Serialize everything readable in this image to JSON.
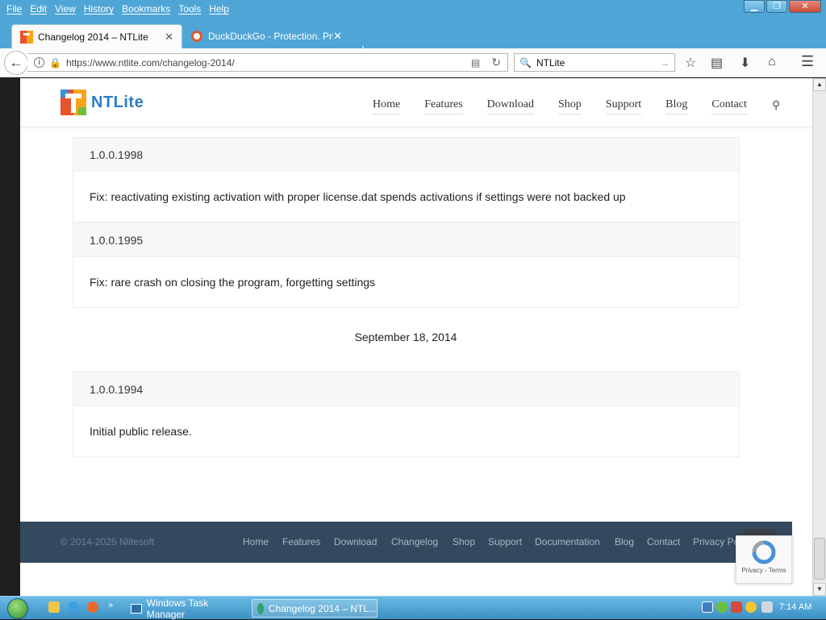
{
  "menubar": {
    "items": [
      "File",
      "Edit",
      "View",
      "History",
      "Bookmarks",
      "Tools",
      "Help"
    ]
  },
  "tabs": [
    {
      "title": "Changelog 2014 – NTLite",
      "active": true
    },
    {
      "title": "DuckDuckGo - Protection. Priva",
      "active": false
    }
  ],
  "navbar": {
    "url": "https://www.ntlite.com/changelog-2014/",
    "url_domain": "ntlite.com",
    "search_value": "NTLite"
  },
  "site": {
    "logo_text": "NTLite",
    "nav": [
      "Home",
      "Features",
      "Download",
      "Shop",
      "Support",
      "Blog",
      "Contact"
    ]
  },
  "entries": [
    {
      "version": "1.0.0.1998",
      "text": "Fix: reactivating existing activation with proper license.dat spends activations if settings were not backed up"
    },
    {
      "version": "1.0.0.1995",
      "text": "Fix: rare crash on closing the program, forgetting settings"
    },
    {
      "version": "1.0.0.1994",
      "text": "Initial public release."
    }
  ],
  "date_heading": "September 18, 2014",
  "footer": {
    "copyright": "© 2014-2025 Nlitesoft",
    "links": [
      "Home",
      "Features",
      "Download",
      "Changelog",
      "Shop",
      "Support",
      "Documentation",
      "Blog",
      "Contact",
      "Privacy Policy"
    ]
  },
  "recaptcha": {
    "text": "Privacy - Terms"
  },
  "taskbar": {
    "items": [
      "Windows Task Manager",
      "Changelog 2014 – NTL..."
    ],
    "clock": "7:14 AM"
  },
  "colors": {
    "nav_chrome": "#4fa6d6",
    "footer_bg": "#33495e",
    "brand": "#2b7ec4"
  }
}
